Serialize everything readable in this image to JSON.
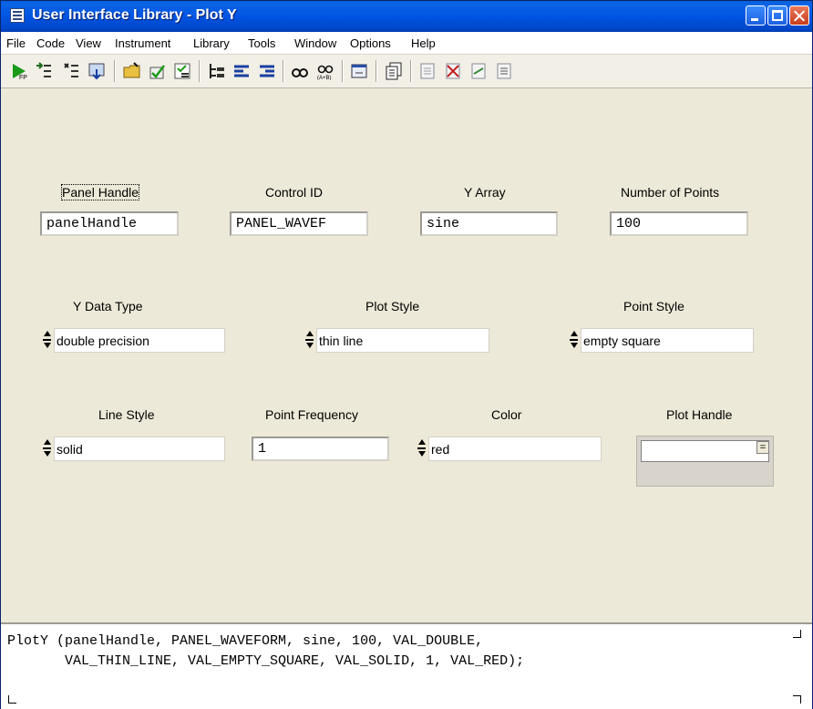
{
  "window": {
    "title": "User Interface Library - Plot Y"
  },
  "menu": [
    "File",
    "Code",
    "View",
    "Instrument",
    "Library",
    "Tools",
    "Window",
    "Options",
    "Help"
  ],
  "toolbar": {
    "icons": [
      "run-icon",
      "select-icon",
      "insert-icon",
      "goto-icon",
      "open-icon",
      "check-icon",
      "list-icon",
      "tree-icon",
      "tab-icon",
      "untab-icon",
      "find-icon",
      "find-replace-icon",
      "edit-icon",
      "copy-icon",
      "panel-icon",
      "panel-close-icon",
      "panel-arrange-icon",
      "panel-edit-icon"
    ]
  },
  "fields": {
    "panel_handle": {
      "label": "Panel Handle",
      "value": "panelHandle"
    },
    "control_id": {
      "label": "Control ID",
      "value": "PANEL_WAVEF"
    },
    "y_array": {
      "label": "Y Array",
      "value": "sine"
    },
    "num_points": {
      "label": "Number of Points",
      "value": "100"
    },
    "y_data_type": {
      "label": "Y Data Type",
      "value": "double precision"
    },
    "plot_style": {
      "label": "Plot Style",
      "value": "thin line"
    },
    "point_style": {
      "label": "Point Style",
      "value": "empty square"
    },
    "line_style": {
      "label": "Line Style",
      "value": "solid"
    },
    "point_frequency": {
      "label": "Point Frequency",
      "value": "1"
    },
    "color": {
      "label": "Color",
      "value": "red"
    },
    "plot_handle": {
      "label": "Plot Handle",
      "value": ""
    }
  },
  "code": {
    "line1": "PlotY (panelHandle, PANEL_WAVEFORM, sine, 100, VAL_DOUBLE,",
    "line2": "       VAL_THIN_LINE, VAL_EMPTY_SQUARE, VAL_SOLID, 1, VAL_RED);"
  },
  "colors": {
    "titlebar": "#0054e3",
    "panel": "#ece9d8"
  }
}
